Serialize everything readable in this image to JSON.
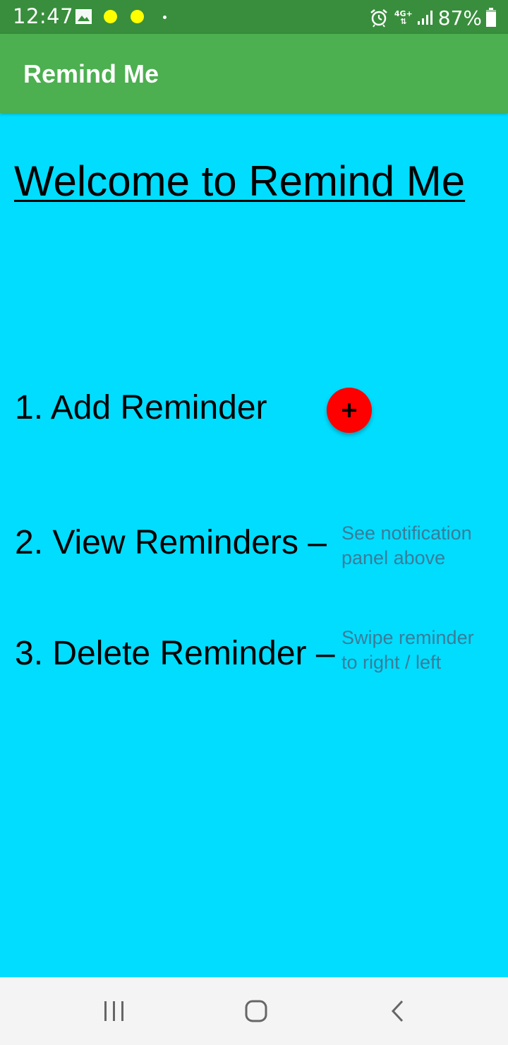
{
  "status_bar": {
    "time": "12:47",
    "network": "4G+",
    "battery": "87%",
    "icons": [
      "gallery-icon",
      "notification-dot",
      "notification-dot",
      "small-dot",
      "alarm-icon",
      "network-4g-icon",
      "signal-icon",
      "battery-icon"
    ]
  },
  "app_bar": {
    "title": "Remind Me"
  },
  "main": {
    "heading": "Welcome to Remind Me",
    "steps": [
      {
        "label": "1. Add Reminder"
      },
      {
        "label": "2. View Reminders –",
        "hint_line1": "See notification",
        "hint_line2": "panel above"
      },
      {
        "label": "3. Delete Reminder –",
        "hint_line1": "Swipe reminder",
        "hint_line2": "to right / left"
      }
    ],
    "add_button_icon": "plus-icon"
  },
  "nav_bar": {
    "items": [
      "recents-icon",
      "home-icon",
      "back-icon"
    ]
  },
  "colors": {
    "status_bar": "#388E3C",
    "app_bar": "#4CAF50",
    "background": "#00DDFF",
    "add_button": "#FF0000",
    "hint_text": "#3A7C9A",
    "notification_dot": "#FFFF00",
    "nav_bar": "#F4F4F4"
  }
}
